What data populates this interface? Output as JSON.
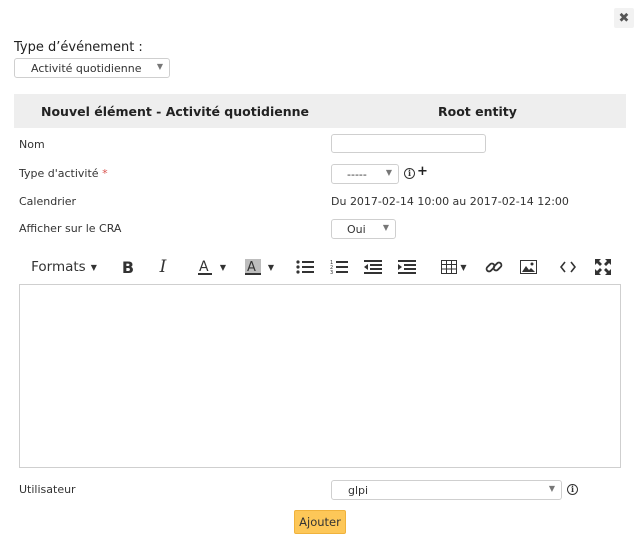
{
  "dialog": {
    "close_symbol": "✖"
  },
  "event_type": {
    "label": "Type d’événement :",
    "selected": "Activité quotidienne"
  },
  "header": {
    "left_title": "Nouvel élément - Activité quotidienne",
    "right_title": "Root entity"
  },
  "form": {
    "name_label": "Nom",
    "name_value": "",
    "activity_type_label": "Type d'activité",
    "activity_type_required": "*",
    "activity_type_selected": "-----",
    "calendar_label": "Calendrier",
    "calendar_value": "Du 2017-02-14 10:00 au 2017-02-14 12:00",
    "show_cra_label": "Afficher sur le CRA",
    "show_cra_selected": "Oui",
    "user_label": "Utilisateur",
    "user_selected": "glpi"
  },
  "editor": {
    "formats_label": "Formats",
    "content": "",
    "toolbar_icons": [
      "bold-icon",
      "italic-icon",
      "text-color-icon",
      "background-color-icon",
      "bullet-list-icon",
      "numbered-list-icon",
      "outdent-icon",
      "indent-icon",
      "table-icon",
      "link-icon",
      "image-icon",
      "source-code-icon",
      "fullscreen-icon"
    ]
  },
  "actions": {
    "submit_label": "Ajouter"
  },
  "colors": {
    "submit_bg": "#fdc758",
    "header_bg": "#eeeeee",
    "required": "#d9534f"
  }
}
